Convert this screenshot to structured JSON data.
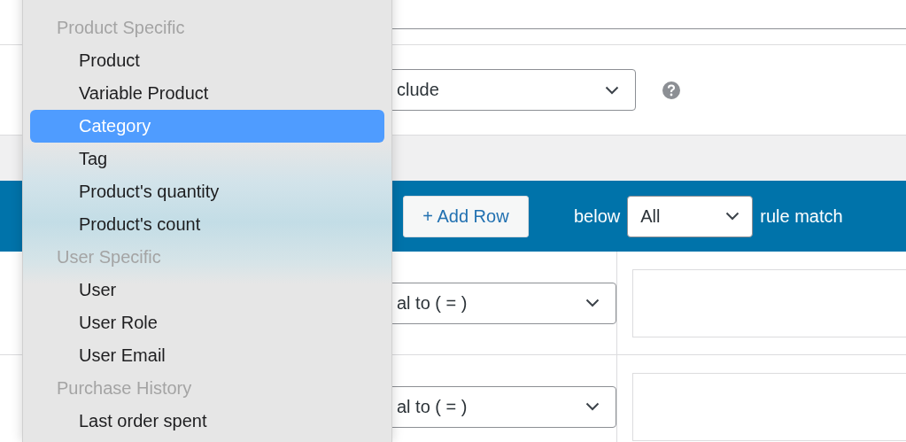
{
  "filter_row": {
    "select_value": "clude"
  },
  "toolbar": {
    "add_row_button": "+ Add Row",
    "match_prefix": "below",
    "match_select": "All",
    "match_suffix": "rule match"
  },
  "rules": [
    {
      "operator": "al to ( = )"
    },
    {
      "operator": "al to ( = )"
    }
  ],
  "dropdown_menu": {
    "items": [
      {
        "kind": "header",
        "label": "Product Specific"
      },
      {
        "kind": "option",
        "label": "Product",
        "selected": false
      },
      {
        "kind": "option",
        "label": "Variable Product",
        "selected": false
      },
      {
        "kind": "option",
        "label": "Category",
        "selected": true
      },
      {
        "kind": "option",
        "label": "Tag",
        "selected": false
      },
      {
        "kind": "option",
        "label": "Product's quantity",
        "selected": false
      },
      {
        "kind": "option",
        "label": "Product's count",
        "selected": false
      },
      {
        "kind": "header",
        "label": "User Specific"
      },
      {
        "kind": "option",
        "label": "User",
        "selected": false
      },
      {
        "kind": "option",
        "label": "User Role",
        "selected": false
      },
      {
        "kind": "option",
        "label": "User Email",
        "selected": false
      },
      {
        "kind": "header",
        "label": "Purchase History"
      },
      {
        "kind": "option",
        "label": "Last order spent",
        "selected": false
      }
    ]
  }
}
